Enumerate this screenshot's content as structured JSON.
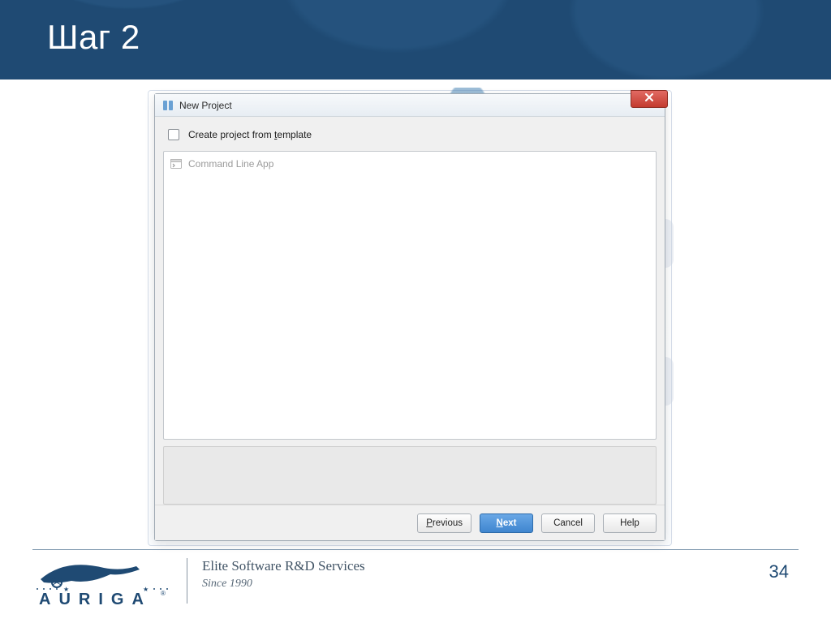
{
  "slide": {
    "title": "Шаг 2",
    "page_number": "34"
  },
  "dialog": {
    "title": "New Project",
    "create_from_template_pre": "Create project from ",
    "create_from_template_u": "t",
    "create_from_template_post": "emplate",
    "templates": [
      {
        "label": "Command Line App"
      }
    ],
    "buttons": {
      "previous": {
        "u": "P",
        "rest": "revious"
      },
      "next": {
        "u": "N",
        "rest": "ext"
      },
      "cancel": "Cancel",
      "help": "Help"
    }
  },
  "footer": {
    "brand": "AURIGA",
    "tagline": "Elite Software R&D Services",
    "since": "Since 1990"
  }
}
